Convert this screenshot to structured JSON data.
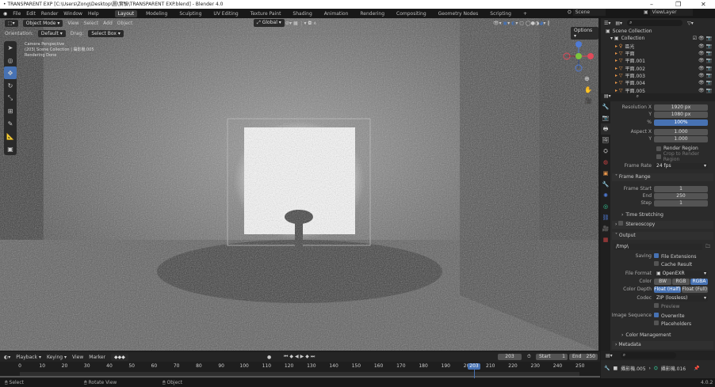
{
  "title": "• TRANSPARENT EXP [C:\\Users\\Zong\\Desktop\\圖\\實驗\\TRANSPARENT EXP.blend] - Blender 4.0",
  "window_controls": [
    "–",
    "❐",
    "✕"
  ],
  "menu": [
    "File",
    "Edit",
    "Render",
    "Window",
    "Help"
  ],
  "workspaces": [
    "Layout",
    "Modeling",
    "Sculpting",
    "UV Editing",
    "Texture Paint",
    "Shading",
    "Animation",
    "Rendering",
    "Compositing",
    "Geometry Nodes",
    "Scripting",
    "+"
  ],
  "active_workspace": "Layout",
  "scene": "Scene",
  "view_layer": "ViewLayer",
  "viewport": {
    "mode": "Object Mode",
    "menus": [
      "View",
      "Select",
      "Add",
      "Object"
    ],
    "transform": "Global",
    "orientation_label": "Orientation:",
    "orientation": "Default",
    "drag_label": "Drag:",
    "drag": "Select Box",
    "options": "Options",
    "overlay_lines": [
      "Camera Perspective",
      "(203) Scene Collection | 攝影機.005",
      "Rendering Done"
    ],
    "accent": "#4772b3"
  },
  "outliner": {
    "root": "Scene Collection",
    "collection": "Collection",
    "items": [
      "區光",
      "平面",
      "平面.001",
      "平面.002",
      "平面.003",
      "平面.004",
      "平面.005"
    ]
  },
  "properties": {
    "resolution_x_label": "Resolution X",
    "resolution_x": "1920 px",
    "y_label": "Y",
    "resolution_y": "1080 px",
    "pct_label": "%",
    "resolution_pct": "100%",
    "aspect_x_label": "Aspect X",
    "aspect_x": "1.000",
    "aspect_y": "1.000",
    "render_region": "Render Region",
    "crop": "Crop to Render Region",
    "frame_rate_label": "Frame Rate",
    "frame_rate": "24 fps",
    "frame_range": "Frame Range",
    "frame_start_label": "Frame Start",
    "frame_start": "1",
    "end_label": "End",
    "end": "250",
    "step_label": "Step",
    "step": "1",
    "time_stretching": "Time Stretching",
    "stereoscopy": "Stereoscopy",
    "output": "Output",
    "output_path": "/tmp\\",
    "saving_label": "Saving",
    "file_extensions": "File Extensions",
    "cache_result": "Cache Result",
    "file_format_label": "File Format",
    "file_format": "OpenEXR",
    "color_label": "Color",
    "color_options": [
      "BW",
      "RGB",
      "RGBA"
    ],
    "color_selected": "RGBA",
    "color_depth_label": "Color Depth",
    "depth_options": [
      "Float (Half)",
      "Float (Full)"
    ],
    "depth_selected": "Float (Half)",
    "codec_label": "Codec",
    "codec": "ZIP (lossless)",
    "preview": "Preview",
    "image_sequence_label": "Image Sequence",
    "overwrite": "Overwrite",
    "placeholders": "Placeholders",
    "color_management": "Color Management",
    "metadata": "Metadata"
  },
  "timeline": {
    "menus": [
      "Playback",
      "Keying",
      "View",
      "Marker"
    ],
    "current_frame": "203",
    "start_label": "Start",
    "start": "1",
    "end_label": "End",
    "end": "250",
    "ticks": [
      "0",
      "10",
      "20",
      "30",
      "40",
      "50",
      "60",
      "70",
      "80",
      "90",
      "100",
      "110",
      "120",
      "130",
      "140",
      "150",
      "160",
      "170",
      "180",
      "190",
      "200",
      "210",
      "220",
      "230",
      "240",
      "250"
    ]
  },
  "bottom_right": {
    "camera": "攝影機.005",
    "camera_data": "攝影機.016"
  },
  "status": {
    "select": "Select",
    "rotate": "Rotate View",
    "object": "Object",
    "version": "4.0.2"
  }
}
